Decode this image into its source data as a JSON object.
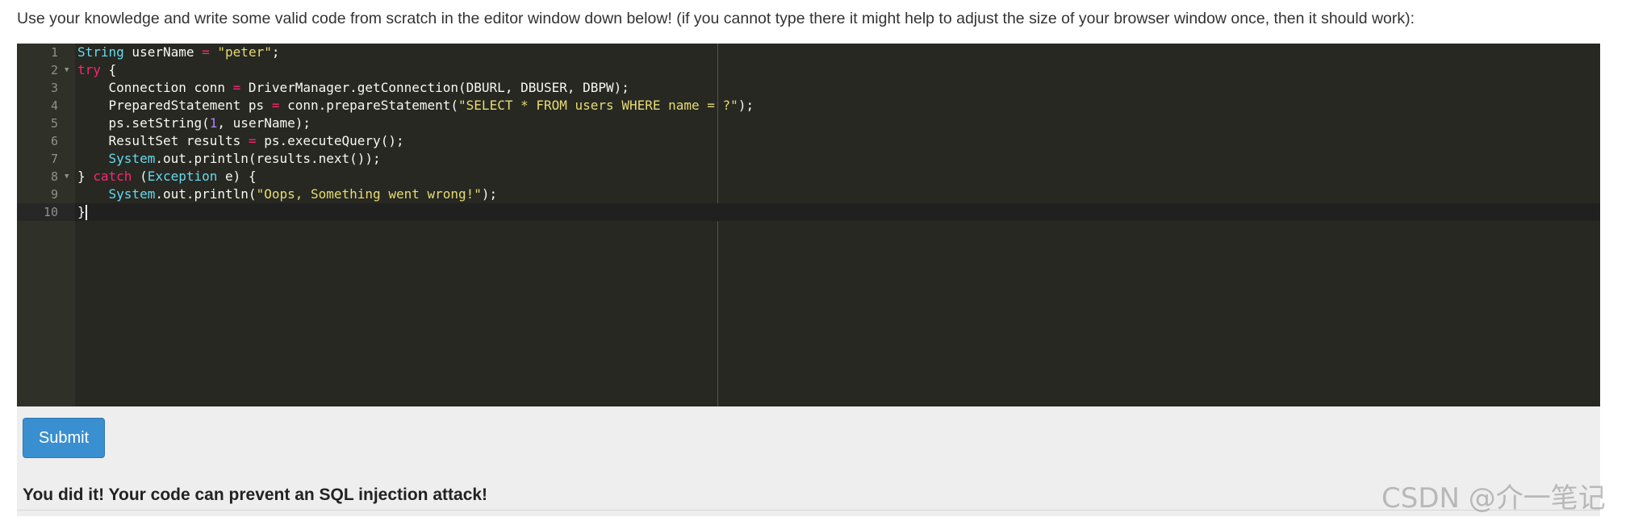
{
  "instructions": "Use your knowledge and write some valid code from scratch in the editor window down below! (if you cannot type there it might help to adjust the size of your browser window once, then it should work):",
  "editor": {
    "theme": "monokai",
    "active_line": 10,
    "lines": [
      {
        "num": "1",
        "fold": false,
        "tokens": [
          {
            "t": "String",
            "c": "#66d9ef"
          },
          {
            "t": " userName ",
            "c": "#f8f8f2"
          },
          {
            "t": "=",
            "c": "#f92672"
          },
          {
            "t": " ",
            "c": "#f8f8f2"
          },
          {
            "t": "\"peter\"",
            "c": "#e6db74"
          },
          {
            "t": ";",
            "c": "#f8f8f2"
          }
        ]
      },
      {
        "num": "2",
        "fold": true,
        "tokens": [
          {
            "t": "try",
            "c": "#f92672"
          },
          {
            "t": " {",
            "c": "#f8f8f2"
          }
        ]
      },
      {
        "num": "3",
        "fold": false,
        "tokens": [
          {
            "t": "    Connection conn ",
            "c": "#f8f8f2"
          },
          {
            "t": "=",
            "c": "#f92672"
          },
          {
            "t": " DriverManager.getConnection(DBURL, DBUSER, DBPW);",
            "c": "#f8f8f2"
          }
        ]
      },
      {
        "num": "4",
        "fold": false,
        "tokens": [
          {
            "t": "    PreparedStatement ps ",
            "c": "#f8f8f2"
          },
          {
            "t": "=",
            "c": "#f92672"
          },
          {
            "t": " conn.prepareStatement(",
            "c": "#f8f8f2"
          },
          {
            "t": "\"SELECT * FROM users WHERE name = ?\"",
            "c": "#e6db74"
          },
          {
            "t": ");",
            "c": "#f8f8f2"
          }
        ]
      },
      {
        "num": "5",
        "fold": false,
        "tokens": [
          {
            "t": "    ps.setString(",
            "c": "#f8f8f2"
          },
          {
            "t": "1",
            "c": "#ae81ff"
          },
          {
            "t": ", userName);",
            "c": "#f8f8f2"
          }
        ]
      },
      {
        "num": "6",
        "fold": false,
        "tokens": [
          {
            "t": "    ResultSet results ",
            "c": "#f8f8f2"
          },
          {
            "t": "=",
            "c": "#f92672"
          },
          {
            "t": " ps.executeQuery();",
            "c": "#f8f8f2"
          }
        ]
      },
      {
        "num": "7",
        "fold": false,
        "tokens": [
          {
            "t": "    ",
            "c": "#f8f8f2"
          },
          {
            "t": "System",
            "c": "#66d9ef"
          },
          {
            "t": ".out.println(results.next());",
            "c": "#f8f8f2"
          }
        ]
      },
      {
        "num": "8",
        "fold": true,
        "tokens": [
          {
            "t": "} ",
            "c": "#f8f8f2"
          },
          {
            "t": "catch",
            "c": "#f92672"
          },
          {
            "t": " (",
            "c": "#f8f8f2"
          },
          {
            "t": "Exception",
            "c": "#66d9ef"
          },
          {
            "t": " e) {",
            "c": "#f8f8f2"
          }
        ]
      },
      {
        "num": "9",
        "fold": false,
        "tokens": [
          {
            "t": "    ",
            "c": "#f8f8f2"
          },
          {
            "t": "System",
            "c": "#66d9ef"
          },
          {
            "t": ".out.println(",
            "c": "#f8f8f2"
          },
          {
            "t": "\"Oops, Something went wrong!\"",
            "c": "#e6db74"
          },
          {
            "t": ");",
            "c": "#f8f8f2"
          }
        ]
      },
      {
        "num": "10",
        "fold": false,
        "tokens": [
          {
            "t": "}",
            "c": "#f8f8f2"
          }
        ]
      }
    ]
  },
  "submit_label": "Submit",
  "result_message": "You did it! Your code can prevent an SQL injection attack!",
  "watermark": "CSDN @介一笔记",
  "colors": {
    "editor_bg": "#272822",
    "gutter_bg": "#2f3129",
    "submit_bg": "#3a8fd0",
    "panel_bg": "#eeeeee"
  }
}
